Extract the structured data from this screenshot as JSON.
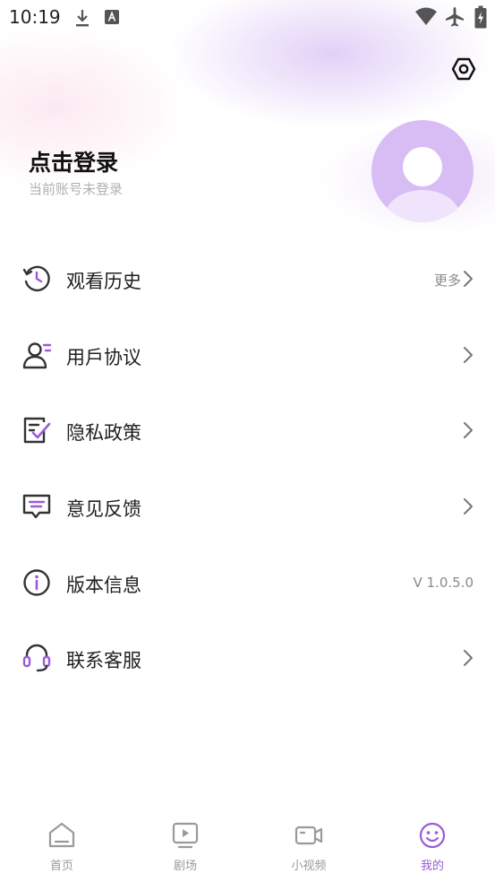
{
  "status_bar": {
    "time": "10:19"
  },
  "profile": {
    "title": "点击登录",
    "subtitle": "当前账号未登录"
  },
  "menu": [
    {
      "label": "观看历史",
      "extra": "更多",
      "icon": "history-icon"
    },
    {
      "label": "用戶协议",
      "extra": "",
      "icon": "user-agreement-icon"
    },
    {
      "label": "隐私政策",
      "extra": "",
      "icon": "privacy-policy-icon"
    },
    {
      "label": "意见反馈",
      "extra": "",
      "icon": "feedback-icon"
    },
    {
      "label": "版本信息",
      "extra": "V 1.0.5.0",
      "icon": "info-icon"
    },
    {
      "label": "联系客服",
      "extra": "",
      "icon": "headset-icon"
    }
  ],
  "tabs": [
    {
      "label": "首页",
      "icon": "home-icon",
      "active": false
    },
    {
      "label": "剧场",
      "icon": "theater-icon",
      "active": false
    },
    {
      "label": "小视频",
      "icon": "video-camera-icon",
      "active": false
    },
    {
      "label": "我的",
      "icon": "smiley-icon",
      "active": true
    }
  ],
  "colors": {
    "accent": "#9a5bd9",
    "avatar_bg": "#d7bdf4"
  }
}
